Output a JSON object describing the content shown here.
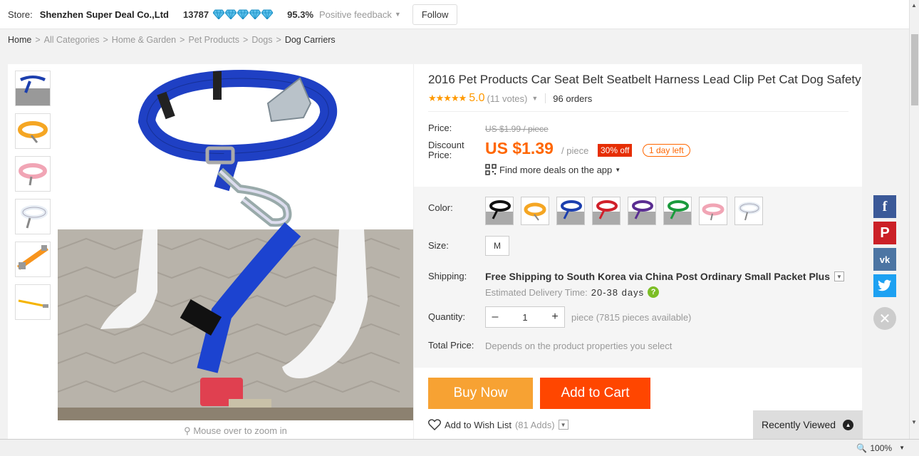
{
  "store": {
    "label": "Store:",
    "name": "Shenzhen Super Deal Co.,Ltd",
    "score": "13787",
    "positive_pct": "95.3%",
    "positive_label": "Positive feedback",
    "follow": "Follow"
  },
  "breadcrumb": {
    "home": "Home",
    "items": [
      "All Categories",
      "Home & Garden",
      "Pet Products",
      "Dogs"
    ],
    "last": "Dog Carriers",
    "sep": ">"
  },
  "gallery": {
    "zoom_hint": "Mouse over to zoom in"
  },
  "product": {
    "title": "2016 Pet Products Car Seat Belt Seatbelt Harness Lead Clip Pet Cat Dog Safety",
    "stars": "★★★★★",
    "rating": "5.0",
    "votes": "(11 votes)",
    "orders": "96 orders",
    "price_label": "Price:",
    "old_price": "US $1.99 / piece",
    "discount_label": "Discount Price:",
    "price": "US $1.39",
    "per": "/ piece",
    "off": "30% off",
    "time_left": "1 day left",
    "deals": "Find more deals on the app",
    "color_label": "Color:",
    "colors": [
      "black",
      "orange",
      "blue",
      "red",
      "purple",
      "green",
      "pink",
      "white"
    ],
    "size_label": "Size:",
    "size": "M",
    "shipping_label": "Shipping:",
    "shipping_free": "Free Shipping to",
    "shipping_dest": "South Korea via China Post Ordinary Small Packet Plus",
    "delivery_label": "Estimated Delivery Time:",
    "delivery_days": "20-38 days",
    "quantity_label": "Quantity:",
    "quantity": "1",
    "available": "piece (7815 pieces available)",
    "total_label": "Total Price:",
    "total_text": "Depends on the product properties you select",
    "buy_now": "Buy Now",
    "add_to_cart": "Add to Cart",
    "wishlist": "Add to Wish List",
    "wish_adds": "(81 Adds)"
  },
  "recently_viewed": "Recently Viewed",
  "social": [
    "facebook",
    "pinterest",
    "vk",
    "twitter"
  ],
  "zoom_level": "100%"
}
